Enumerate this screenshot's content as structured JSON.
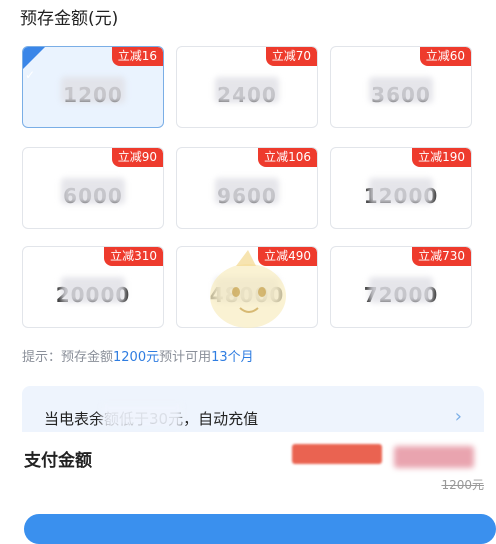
{
  "section_title": "预存金额(元)",
  "cards": [
    {
      "amount": "1200",
      "discount": "立减16",
      "selected": true
    },
    {
      "amount": "2400",
      "discount": "立减70",
      "selected": false
    },
    {
      "amount": "3600",
      "discount": "立减60",
      "selected": false
    },
    {
      "amount": "6000",
      "discount": "立减90",
      "selected": false
    },
    {
      "amount": "9600",
      "discount": "立减106",
      "selected": false
    },
    {
      "amount": "12000",
      "discount": "立减190",
      "selected": false
    },
    {
      "amount": "20000",
      "discount": "立减310",
      "selected": false
    },
    {
      "amount": "48000",
      "discount": "立减490",
      "selected": false
    },
    {
      "amount": "72000",
      "discount": "立减730",
      "selected": false
    }
  ],
  "hint": {
    "prefix": "提示：预存金额",
    "amount": "1200元",
    "mid": "预计可用",
    "months": "13个月"
  },
  "banner": {
    "text": "当电表余额低于30元，自动充值",
    "arrow": "›"
  },
  "pay": {
    "label": "支付金额",
    "original": "1200元"
  },
  "colors": {
    "accent": "#3a86e8",
    "badge": "#ee3b2d",
    "highlight": "#2f7de1"
  }
}
